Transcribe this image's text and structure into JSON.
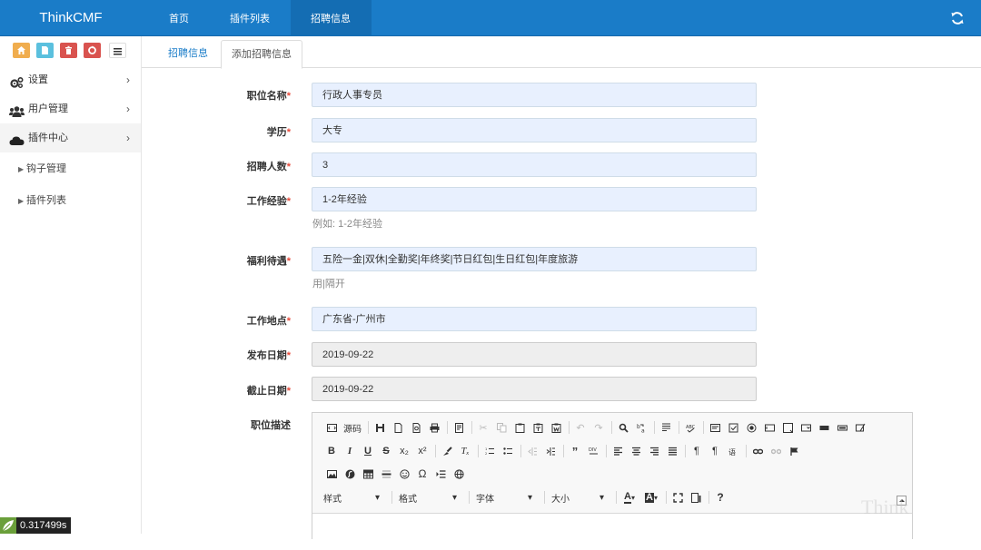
{
  "header": {
    "brand": "ThinkCMF",
    "nav": [
      "首页",
      "插件列表",
      "招聘信息"
    ],
    "active_nav": "招聘信息",
    "accent": "#1a7cc8"
  },
  "sidebar": {
    "shortcut_icons": [
      "home-icon",
      "file-icon",
      "trash-icon",
      "recycle-icon",
      "list-icon"
    ],
    "menu": [
      {
        "label": "设置",
        "icon": "gears-icon"
      },
      {
        "label": "用户管理",
        "icon": "users-icon"
      },
      {
        "label": "插件中心",
        "icon": "cloud-icon"
      }
    ],
    "submenu": [
      {
        "label": "钩子管理"
      },
      {
        "label": "插件列表"
      }
    ]
  },
  "tabs": {
    "list": "招聘信息",
    "add": "添加招聘信息"
  },
  "form": {
    "fields": [
      {
        "label": "职位名称",
        "value": "行政人事专员"
      },
      {
        "label": "学历",
        "value": "大专"
      },
      {
        "label": "招聘人数",
        "value": "3"
      },
      {
        "label": "工作经验",
        "value": "1-2年经验",
        "help": "例如: 1-2年经验"
      },
      {
        "label": "福利待遇",
        "value": "五险一金|双休|全勤奖|年终奖|节日红包|生日红包|年度旅游",
        "help": "用|隔开"
      },
      {
        "label": "工作地点",
        "value": "广东省-广州市"
      },
      {
        "label": "发布日期",
        "value": "2019-09-22"
      },
      {
        "label": "截止日期",
        "value": "2019-09-22"
      }
    ],
    "description_label": "职位描述",
    "required_mark": "*"
  },
  "editor": {
    "source_label": "源码",
    "combos": [
      "样式",
      "格式",
      "字体",
      "大小"
    ]
  },
  "debug": {
    "timer": "0.317499s"
  },
  "watermark": "Think"
}
